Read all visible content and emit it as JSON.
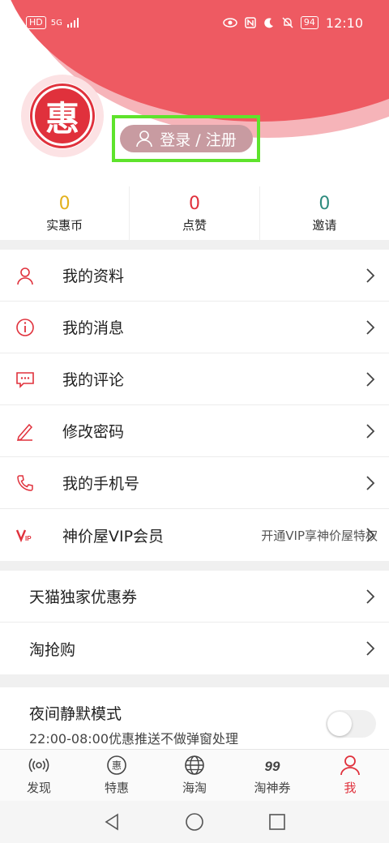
{
  "status_bar": {
    "hd": "HD",
    "signal": "5G",
    "battery": "94",
    "time": "12:10"
  },
  "header": {
    "logo_char": "惠",
    "login_label": "登录 / 注册"
  },
  "stats": [
    {
      "value": "0",
      "label": "实惠币",
      "color": "#e3b11d"
    },
    {
      "value": "0",
      "label": "点赞",
      "color": "#e0313c"
    },
    {
      "value": "0",
      "label": "邀请",
      "color": "#2e8b7e"
    }
  ],
  "menu_group1": [
    {
      "label": "我的资料",
      "icon": "person-icon"
    },
    {
      "label": "我的消息",
      "icon": "info-icon"
    },
    {
      "label": "我的评论",
      "icon": "comment-icon"
    },
    {
      "label": "修改密码",
      "icon": "pencil-icon"
    },
    {
      "label": "我的手机号",
      "icon": "phone-icon"
    },
    {
      "label": "神价屋VIP会员",
      "icon": "vip-icon",
      "hint": "开通VIP享神价屋特权"
    }
  ],
  "menu_group2": [
    {
      "label": "天猫独家优惠券"
    },
    {
      "label": "淘抢购"
    }
  ],
  "night_mode": {
    "title": "夜间静默模式",
    "subtitle": "22:00-08:00优惠推送不做弹窗处理",
    "enabled": false
  },
  "tabbar": [
    {
      "label": "发现",
      "icon": "discover-icon"
    },
    {
      "label": "特惠",
      "icon": "deal-icon"
    },
    {
      "label": "海淘",
      "icon": "globe-icon"
    },
    {
      "label": "淘神券",
      "icon": "coupon-icon"
    },
    {
      "label": "我",
      "icon": "user-icon",
      "active": true
    }
  ],
  "colors": {
    "accent": "#e0313c",
    "header_red": "#ee5a62"
  }
}
